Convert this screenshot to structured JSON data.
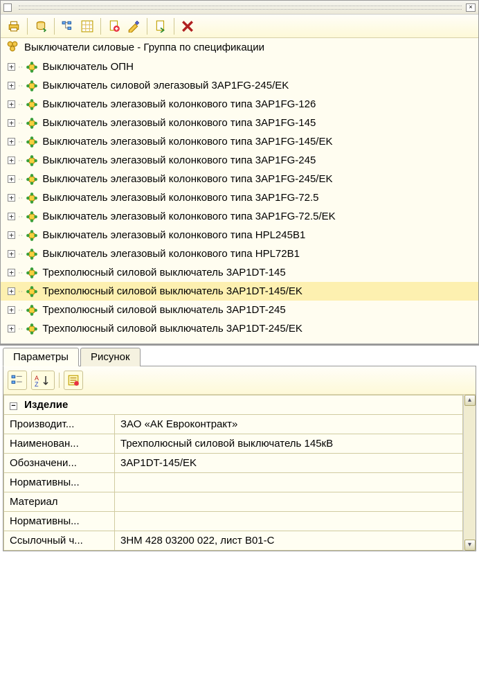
{
  "header": {
    "title": "Выключатели силовые - Группа по спецификации"
  },
  "tree": {
    "items": [
      {
        "label": "Выключатель ОПН"
      },
      {
        "label": "Выключатель силовой элегазовый 3AP1FG-245/EK"
      },
      {
        "label": "Выключатель элегазовый колонкового типа 3AP1FG-126"
      },
      {
        "label": "Выключатель элегазовый колонкового типа 3AP1FG-145"
      },
      {
        "label": "Выключатель элегазовый колонкового типа 3AP1FG-145/EK"
      },
      {
        "label": "Выключатель элегазовый колонкового типа 3AP1FG-245"
      },
      {
        "label": "Выключатель элегазовый колонкового типа 3AP1FG-245/EK"
      },
      {
        "label": "Выключатель элегазовый колонкового типа 3AP1FG-72.5"
      },
      {
        "label": "Выключатель элегазовый колонкового типа 3AP1FG-72.5/EK"
      },
      {
        "label": "Выключатель элегазовый колонкового типа HPL245B1"
      },
      {
        "label": "Выключатель элегазовый колонкового типа HPL72B1"
      },
      {
        "label": "Трехполюсный силовой выключатель 3AP1DT-145"
      },
      {
        "label": "Трехполюсный силовой выключатель 3AP1DT-145/EK",
        "selected": true
      },
      {
        "label": "Трехполюсный силовой выключатель 3AP1DT-245"
      },
      {
        "label": "Трехполюсный силовой выключатель 3AP1DT-245/EK"
      }
    ]
  },
  "tabs": {
    "params": "Параметры",
    "picture": "Рисунок"
  },
  "props": {
    "section": "Изделие",
    "rows": [
      {
        "label": "Производит...",
        "value": "ЗАО «АК Евроконтракт»"
      },
      {
        "label": "Наименован...",
        "value": "Трехполюсный силовой выключатель 145кВ"
      },
      {
        "label": "Обозначени...",
        "value": "3AP1DT-145/EK"
      },
      {
        "label": "Нормативны...",
        "value": ""
      },
      {
        "label": "Материал",
        "value": ""
      },
      {
        "label": "Нормативны...",
        "value": ""
      },
      {
        "label": "Ссылочный ч...",
        "value": "3НМ 428 03200 022, лист В01-С"
      }
    ]
  }
}
